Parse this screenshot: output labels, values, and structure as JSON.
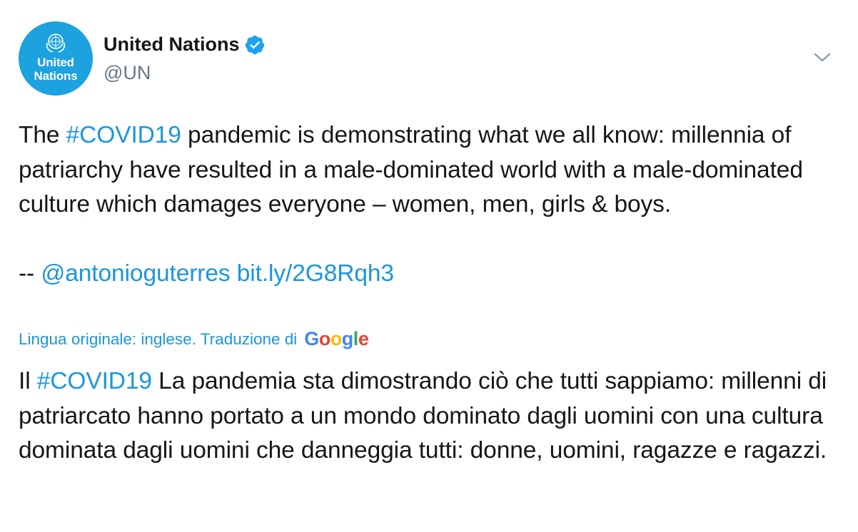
{
  "author": {
    "avatar_text_line1": "United",
    "avatar_text_line2": "Nations",
    "display_name": "United Nations",
    "handle": "@UN",
    "verified_icon": "verified-badge-icon",
    "menu_icon": "chevron-down-icon"
  },
  "tweet": {
    "text_before_hashtag": "The ",
    "hashtag": "#COVID19",
    "text_after_hashtag": " pandemic is demonstrating what we all know: millennia of patriarchy have resulted in a male-dominated world with a male-dominated culture which damages everyone – women, men, girls & boys.",
    "signature_prefix": "-- ",
    "mention": "@antonioguterres",
    "url": "bit.ly/2G8Rqh3"
  },
  "translation": {
    "note": "Lingua originale: inglese. Traduzione di",
    "provider_letters": [
      "G",
      "o",
      "o",
      "g",
      "l",
      "e"
    ],
    "prefix": "Il ",
    "hashtag": "#COVID19",
    "text": " La pandemia sta dimostrando ciò che tutti sappiamo: millenni di patriarcato hanno portato a un mondo dominato dagli uomini con una cultura dominata dagli uomini che danneggia tutti: donne, uomini, ragazze e ragazzi."
  },
  "colors": {
    "link": "#1b95e0",
    "avatar_bg": "#1da1df",
    "handle_gray": "#657786",
    "google_blue": "#4285f4",
    "google_red": "#ea4335",
    "google_yellow": "#fbbc05",
    "google_green": "#34a853"
  }
}
